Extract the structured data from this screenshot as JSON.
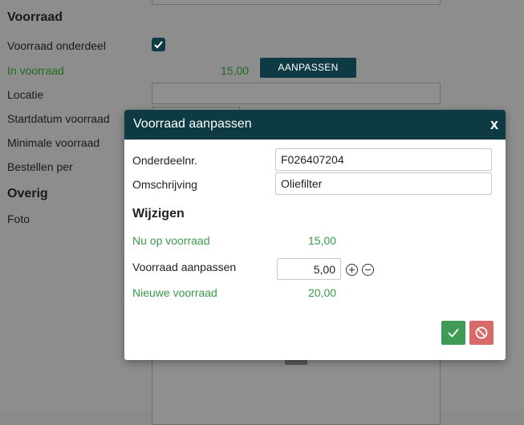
{
  "background": {
    "sections": {
      "voorraad": "Voorraad",
      "overig": "Overig"
    },
    "labels": {
      "voorraad_onderdeel": "Voorraad onderdeel",
      "in_voorraad": "In voorraad",
      "locatie": "Locatie",
      "startdatum_voorraad": "Startdatum voorraad",
      "minimale_voorraad": "Minimale voorraad",
      "bestellen_per": "Bestellen per",
      "foto": "Foto"
    },
    "in_voorraad_value": "15,00",
    "aanpassen_button": "AANPASSEN"
  },
  "modal": {
    "title": "Voorraad aanpassen",
    "close_glyph": "x",
    "fields": {
      "onderdeelnr_label": "Onderdeelnr.",
      "onderdeelnr_value": "F026407204",
      "omschrijving_label": "Omschrijving",
      "omschrijving_value": "Oliefilter"
    },
    "wijzigen_heading": "Wijzigen",
    "nu_op_voorraad_label": "Nu op voorraad",
    "nu_op_voorraad_value": "15,00",
    "voorraad_aanpassen_label": "Voorraad aanpassen",
    "voorraad_aanpassen_value": "5,00",
    "nieuwe_voorraad_label": "Nieuwe voorraad",
    "nieuwe_voorraad_value": "20,00"
  },
  "colors": {
    "header": "#0e3a44",
    "green_text": "#3a9a4a",
    "ok_button": "#3f9a56",
    "cancel_button": "#d96a6a"
  },
  "icons": {
    "checkbox": "check-icon",
    "plus": "plus-circle-icon",
    "minus": "minus-circle-icon",
    "ok": "check-icon",
    "cancel": "ban-icon"
  }
}
